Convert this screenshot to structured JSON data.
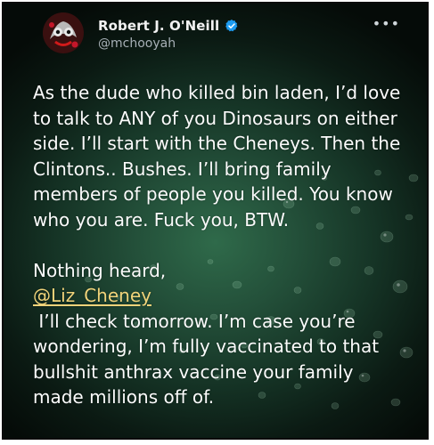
{
  "author": {
    "name": "Robert J. O'Neill",
    "handle": "@mchooyah",
    "verified": true,
    "avatar_icon": "avatar-icon",
    "verified_icon": "verified-badge-icon",
    "more_icon": "more-options-icon",
    "more_glyph": "•••"
  },
  "tweet": {
    "paragraph1": [
      "As the dude who killed bin laden, I’d love",
      "to talk to ANY of you Dinosaurs on either",
      "side. I’ll start with the Cheneys. Then the",
      "Clintons.. Bushes. I’ll bring family",
      "members of people you killed. You know",
      "who you are. Fuck you, BTW."
    ],
    "paragraph2_line1": "Nothing heard,",
    "mention": "@Liz_Cheney",
    "paragraph3": [
      " I’ll check tomorrow. I’m case you’re",
      "wondering, I’m fully vaccinated to that",
      "bullshit anthrax vaccine your family",
      "made millions off of."
    ]
  },
  "colors": {
    "text": "#fbfbfb",
    "handle": "#a7b0b6",
    "mention": "#f0d37a",
    "verified": "#1d9bf0",
    "background_center": "#2f6a4a",
    "background_edge": "#050b08"
  }
}
